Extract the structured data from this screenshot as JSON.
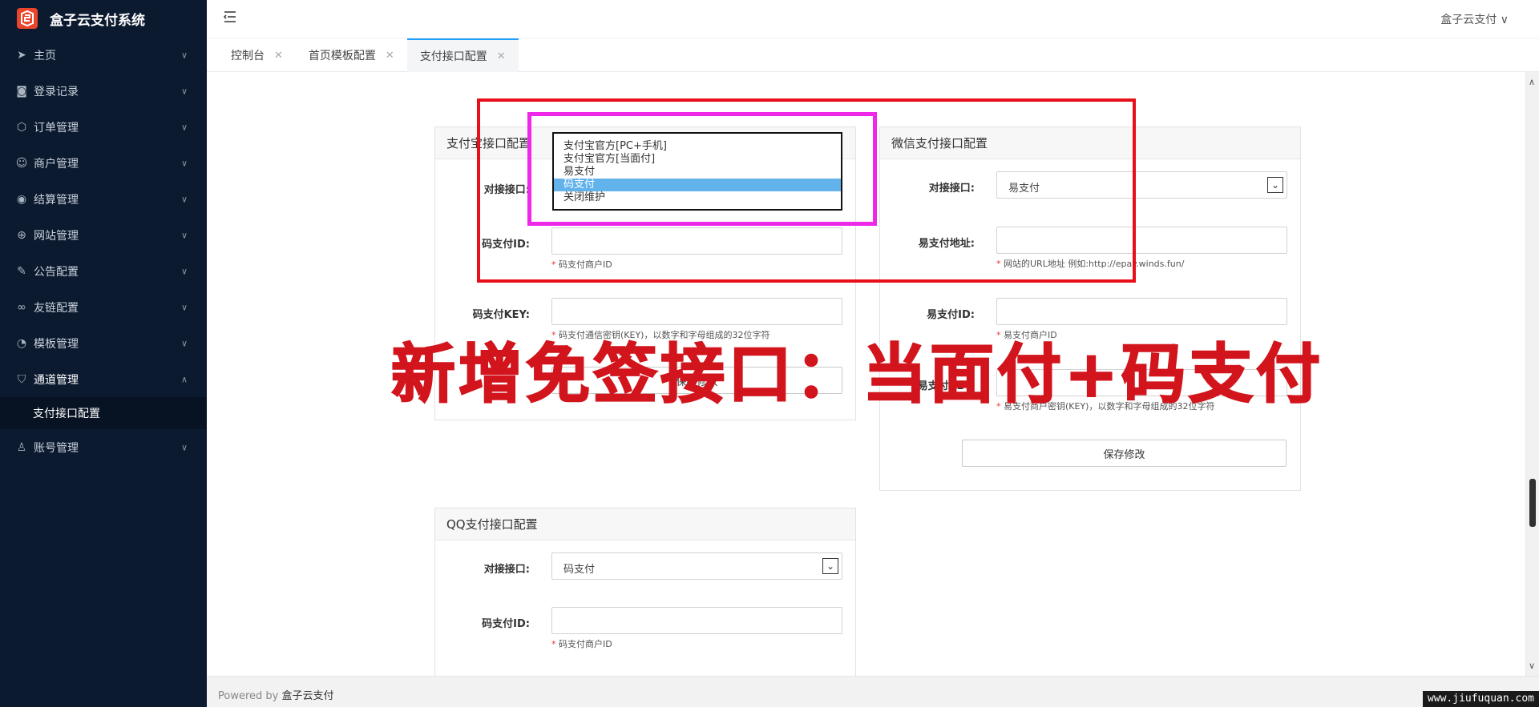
{
  "brand": {
    "title": "盒子云支付系统"
  },
  "sidebar": {
    "items": [
      {
        "label": "主页",
        "icon": "send-icon"
      },
      {
        "label": "登录记录",
        "icon": "camera-icon"
      },
      {
        "label": "订单管理",
        "icon": "box-icon"
      },
      {
        "label": "商户管理",
        "icon": "users-icon"
      },
      {
        "label": "结算管理",
        "icon": "target-icon"
      },
      {
        "label": "网站管理",
        "icon": "plus-circle-icon"
      },
      {
        "label": "公告配置",
        "icon": "pen-icon"
      },
      {
        "label": "友链配置",
        "icon": "link-icon"
      },
      {
        "label": "模板管理",
        "icon": "gauge-icon"
      },
      {
        "label": "通道管理",
        "icon": "shield-icon"
      }
    ],
    "sub_item": "支付接口配置",
    "last_item": {
      "label": "账号管理",
      "icon": "user-icon"
    }
  },
  "header": {
    "user": "盒子云支付 ∨"
  },
  "tabs": [
    {
      "label": "控制台"
    },
    {
      "label": "首页模板配置"
    },
    {
      "label": "支付接口配置"
    }
  ],
  "alipay_panel": {
    "title": "支付宝接口配置",
    "interface_label": "对接接口:",
    "id_label": "码支付ID:",
    "id_hint": "码支付商户ID",
    "key_label": "码支付KEY:",
    "key_hint": "码支付通信密钥(KEY)，以数字和字母组成的32位字符",
    "save": "保存修改"
  },
  "dropdown": {
    "options": [
      "支付宝官方[PC+手机]",
      "支付宝官方[当面付]",
      "易支付",
      "码支付",
      "关闭维护"
    ],
    "selected_index": 3
  },
  "wechat_panel": {
    "title": "微信支付接口配置",
    "interface_label": "对接接口:",
    "interface_value": "易支付",
    "url_label": "易支付地址:",
    "url_hint": "网站的URL地址 例如:http://epay.winds.fun/",
    "id_label": "易支付ID:",
    "id_hint": "易支付商户ID",
    "key_label": "易支付KEY:",
    "key_hint": "易支付商户密钥(KEY)，以数字和字母组成的32位字符",
    "save": "保存修改"
  },
  "qq_panel": {
    "title": "QQ支付接口配置",
    "interface_label": "对接接口:",
    "interface_value": "码支付",
    "id_label": "码支付ID:",
    "id_hint": "码支付商户ID"
  },
  "banner": "新增免签接口：当面付+码支付",
  "footer": {
    "prefix": "Powered by ",
    "brand": "盒子云支付"
  },
  "watermark": "www.jiufuquan.com",
  "colors": {
    "sidebar_bg": "#0c1a2f",
    "highlight_red": "#e80e1a",
    "highlight_pink": "#ee27e8",
    "selected_option": "#62b2ec"
  }
}
